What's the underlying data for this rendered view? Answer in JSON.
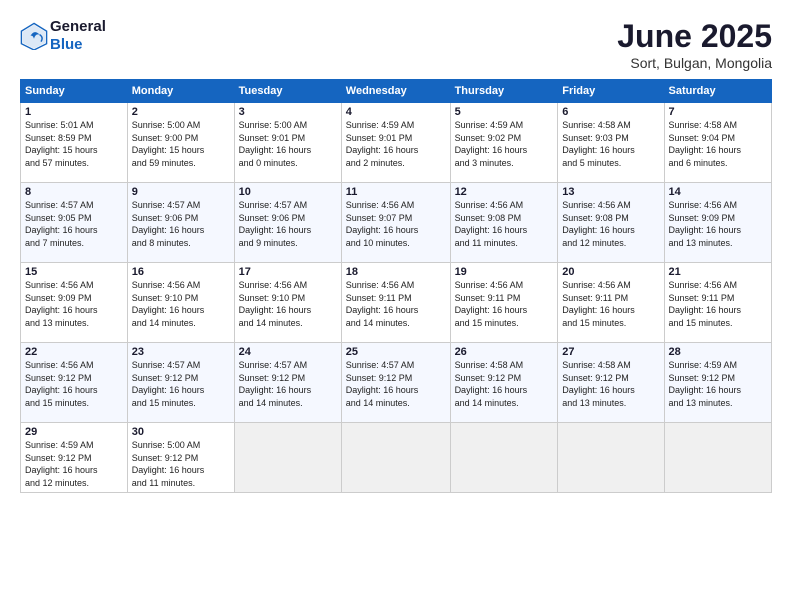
{
  "logo": {
    "general": "General",
    "blue": "Blue"
  },
  "title": "June 2025",
  "location": "Sort, Bulgan, Mongolia",
  "days_of_week": [
    "Sunday",
    "Monday",
    "Tuesday",
    "Wednesday",
    "Thursday",
    "Friday",
    "Saturday"
  ],
  "weeks": [
    [
      {
        "day": "1",
        "info": "Sunrise: 5:01 AM\nSunset: 8:59 PM\nDaylight: 15 hours\nand 57 minutes."
      },
      {
        "day": "2",
        "info": "Sunrise: 5:00 AM\nSunset: 9:00 PM\nDaylight: 15 hours\nand 59 minutes."
      },
      {
        "day": "3",
        "info": "Sunrise: 5:00 AM\nSunset: 9:01 PM\nDaylight: 16 hours\nand 0 minutes."
      },
      {
        "day": "4",
        "info": "Sunrise: 4:59 AM\nSunset: 9:01 PM\nDaylight: 16 hours\nand 2 minutes."
      },
      {
        "day": "5",
        "info": "Sunrise: 4:59 AM\nSunset: 9:02 PM\nDaylight: 16 hours\nand 3 minutes."
      },
      {
        "day": "6",
        "info": "Sunrise: 4:58 AM\nSunset: 9:03 PM\nDaylight: 16 hours\nand 5 minutes."
      },
      {
        "day": "7",
        "info": "Sunrise: 4:58 AM\nSunset: 9:04 PM\nDaylight: 16 hours\nand 6 minutes."
      }
    ],
    [
      {
        "day": "8",
        "info": "Sunrise: 4:57 AM\nSunset: 9:05 PM\nDaylight: 16 hours\nand 7 minutes."
      },
      {
        "day": "9",
        "info": "Sunrise: 4:57 AM\nSunset: 9:06 PM\nDaylight: 16 hours\nand 8 minutes."
      },
      {
        "day": "10",
        "info": "Sunrise: 4:57 AM\nSunset: 9:06 PM\nDaylight: 16 hours\nand 9 minutes."
      },
      {
        "day": "11",
        "info": "Sunrise: 4:56 AM\nSunset: 9:07 PM\nDaylight: 16 hours\nand 10 minutes."
      },
      {
        "day": "12",
        "info": "Sunrise: 4:56 AM\nSunset: 9:08 PM\nDaylight: 16 hours\nand 11 minutes."
      },
      {
        "day": "13",
        "info": "Sunrise: 4:56 AM\nSunset: 9:08 PM\nDaylight: 16 hours\nand 12 minutes."
      },
      {
        "day": "14",
        "info": "Sunrise: 4:56 AM\nSunset: 9:09 PM\nDaylight: 16 hours\nand 13 minutes."
      }
    ],
    [
      {
        "day": "15",
        "info": "Sunrise: 4:56 AM\nSunset: 9:09 PM\nDaylight: 16 hours\nand 13 minutes."
      },
      {
        "day": "16",
        "info": "Sunrise: 4:56 AM\nSunset: 9:10 PM\nDaylight: 16 hours\nand 14 minutes."
      },
      {
        "day": "17",
        "info": "Sunrise: 4:56 AM\nSunset: 9:10 PM\nDaylight: 16 hours\nand 14 minutes."
      },
      {
        "day": "18",
        "info": "Sunrise: 4:56 AM\nSunset: 9:11 PM\nDaylight: 16 hours\nand 14 minutes."
      },
      {
        "day": "19",
        "info": "Sunrise: 4:56 AM\nSunset: 9:11 PM\nDaylight: 16 hours\nand 15 minutes."
      },
      {
        "day": "20",
        "info": "Sunrise: 4:56 AM\nSunset: 9:11 PM\nDaylight: 16 hours\nand 15 minutes."
      },
      {
        "day": "21",
        "info": "Sunrise: 4:56 AM\nSunset: 9:11 PM\nDaylight: 16 hours\nand 15 minutes."
      }
    ],
    [
      {
        "day": "22",
        "info": "Sunrise: 4:56 AM\nSunset: 9:12 PM\nDaylight: 16 hours\nand 15 minutes."
      },
      {
        "day": "23",
        "info": "Sunrise: 4:57 AM\nSunset: 9:12 PM\nDaylight: 16 hours\nand 15 minutes."
      },
      {
        "day": "24",
        "info": "Sunrise: 4:57 AM\nSunset: 9:12 PM\nDaylight: 16 hours\nand 14 minutes."
      },
      {
        "day": "25",
        "info": "Sunrise: 4:57 AM\nSunset: 9:12 PM\nDaylight: 16 hours\nand 14 minutes."
      },
      {
        "day": "26",
        "info": "Sunrise: 4:58 AM\nSunset: 9:12 PM\nDaylight: 16 hours\nand 14 minutes."
      },
      {
        "day": "27",
        "info": "Sunrise: 4:58 AM\nSunset: 9:12 PM\nDaylight: 16 hours\nand 13 minutes."
      },
      {
        "day": "28",
        "info": "Sunrise: 4:59 AM\nSunset: 9:12 PM\nDaylight: 16 hours\nand 13 minutes."
      }
    ],
    [
      {
        "day": "29",
        "info": "Sunrise: 4:59 AM\nSunset: 9:12 PM\nDaylight: 16 hours\nand 12 minutes."
      },
      {
        "day": "30",
        "info": "Sunrise: 5:00 AM\nSunset: 9:12 PM\nDaylight: 16 hours\nand 11 minutes."
      },
      {
        "day": "",
        "info": ""
      },
      {
        "day": "",
        "info": ""
      },
      {
        "day": "",
        "info": ""
      },
      {
        "day": "",
        "info": ""
      },
      {
        "day": "",
        "info": ""
      }
    ]
  ]
}
